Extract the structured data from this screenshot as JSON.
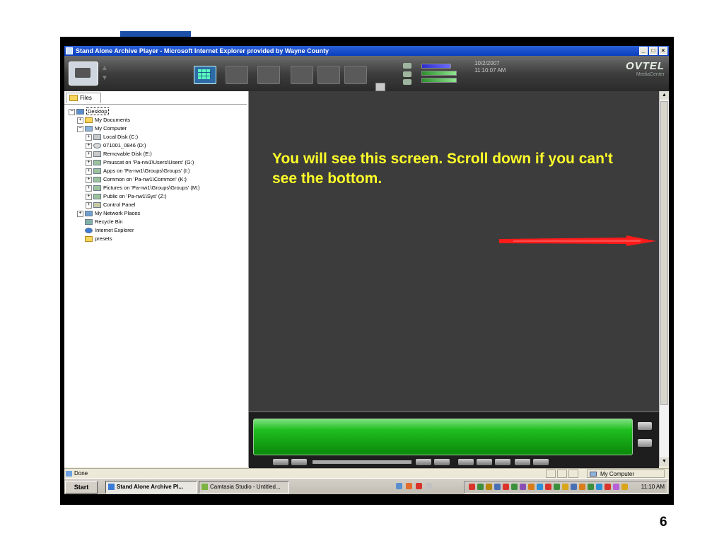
{
  "window": {
    "title": "Stand Alone Archive Player - Microsoft Internet Explorer provided by Wayne County",
    "controls": [
      "_",
      "□",
      "×"
    ]
  },
  "toolbar": {
    "date": "10/2/2007",
    "time": "11:10:07 AM",
    "brand": "OVTEL",
    "brand_sub": "MediaCenter"
  },
  "files_tab": {
    "label": "Files"
  },
  "tree": [
    {
      "label": "Desktop",
      "icon": "desktop-icon",
      "level": 0,
      "expander": "−",
      "selected": true
    },
    {
      "label": "My Documents",
      "icon": "folder-icon",
      "level": 1,
      "expander": "+"
    },
    {
      "label": "My Computer",
      "icon": "computer-icon",
      "level": 1,
      "expander": "−"
    },
    {
      "label": "Local Disk (C:)",
      "icon": "disk-icon",
      "level": 2,
      "expander": "+"
    },
    {
      "label": "071001_0846 (D:)",
      "icon": "cd-icon",
      "level": 2,
      "expander": "+"
    },
    {
      "label": "Removable Disk (E:)",
      "icon": "disk-icon",
      "level": 2,
      "expander": "+"
    },
    {
      "label": "Pmuscat on 'Pa-nw1\\Users\\Users' (G:)",
      "icon": "network-drive-icon",
      "level": 2,
      "expander": "+"
    },
    {
      "label": "Apps on 'Pa-nw1\\Groups\\Groups' (I:)",
      "icon": "network-drive-icon",
      "level": 2,
      "expander": "+"
    },
    {
      "label": "Common on 'Pa-nw1\\Common' (K:)",
      "icon": "network-drive-icon",
      "level": 2,
      "expander": "+"
    },
    {
      "label": "Pictures on 'Pa-nw1\\Groups\\Groups' (M:)",
      "icon": "network-drive-icon",
      "level": 2,
      "expander": "+"
    },
    {
      "label": "Public on 'Pa-nw1\\Sys' (Z:)",
      "icon": "network-drive-icon",
      "level": 2,
      "expander": "+"
    },
    {
      "label": "Control Panel",
      "icon": "control-panel-icon",
      "level": 2,
      "expander": "+"
    },
    {
      "label": "My Network Places",
      "icon": "network-places-icon",
      "level": 1,
      "expander": "+"
    },
    {
      "label": "Recycle Bin",
      "icon": "recycle-bin-icon",
      "level": 1,
      "expander": ""
    },
    {
      "label": "Internet Explorer",
      "icon": "ie-icon",
      "level": 1,
      "expander": ""
    },
    {
      "label": "presets",
      "icon": "folder-icon",
      "level": 1,
      "expander": ""
    }
  ],
  "main": {
    "instruction": "You will see this screen. Scroll down if you can't see the bottom."
  },
  "status": {
    "text": "Done",
    "zone": "My Computer"
  },
  "taskbar": {
    "start": "Start",
    "items": [
      {
        "label": "Stand Alone Archive Pl...",
        "active": true
      },
      {
        "label": "Camtasia Studio - Untitled...",
        "active": false
      }
    ],
    "clock": "11:10 AM"
  },
  "slide_number": "6",
  "colors": {
    "instruction_text": "#ffff2a",
    "arrow": "#ff1a1a",
    "player_bar": "#1fbf1f"
  }
}
